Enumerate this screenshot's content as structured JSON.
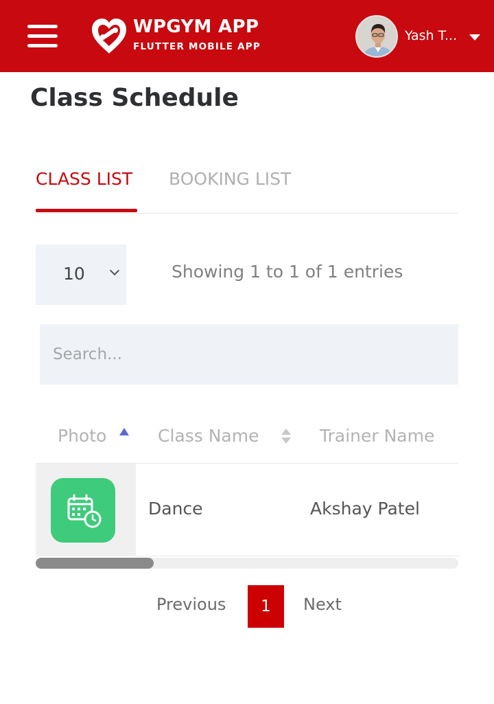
{
  "colors": {
    "brand_red": "#c8090f",
    "active_page_red": "#cc0000",
    "input_bg": "#eff3f8",
    "class_icon_green": "#3ecb7b",
    "sort_active": "#5a6ad0"
  },
  "header": {
    "menu_icon": "hamburger-menu-icon",
    "logo_icon": "heart-logo-icon",
    "app_title": "WPGYM APP",
    "app_subtitle": "FLUTTER MOBILE APP",
    "user_name": "Yash T...",
    "user_menu_icon": "caret-down-icon"
  },
  "page": {
    "title": "Class Schedule"
  },
  "tabs": [
    {
      "label": "CLASS LIST",
      "active": true
    },
    {
      "label": "BOOKING LIST",
      "active": false
    }
  ],
  "entries": {
    "selected": "10",
    "info": "Showing 1 to 1 of 1 entries"
  },
  "search": {
    "placeholder": "Search..."
  },
  "table": {
    "columns": [
      "Photo",
      "Class Name",
      "Trainer Name"
    ],
    "sorted_column": "Photo",
    "sort_direction": "asc",
    "rows": [
      {
        "photo_icon": "calendar-clock-icon",
        "class_name": "Dance",
        "trainer_name": "Akshay Patel"
      }
    ],
    "scroll_position": 0
  },
  "pagination": {
    "previous": "Previous",
    "current": "1",
    "next": "Next"
  }
}
